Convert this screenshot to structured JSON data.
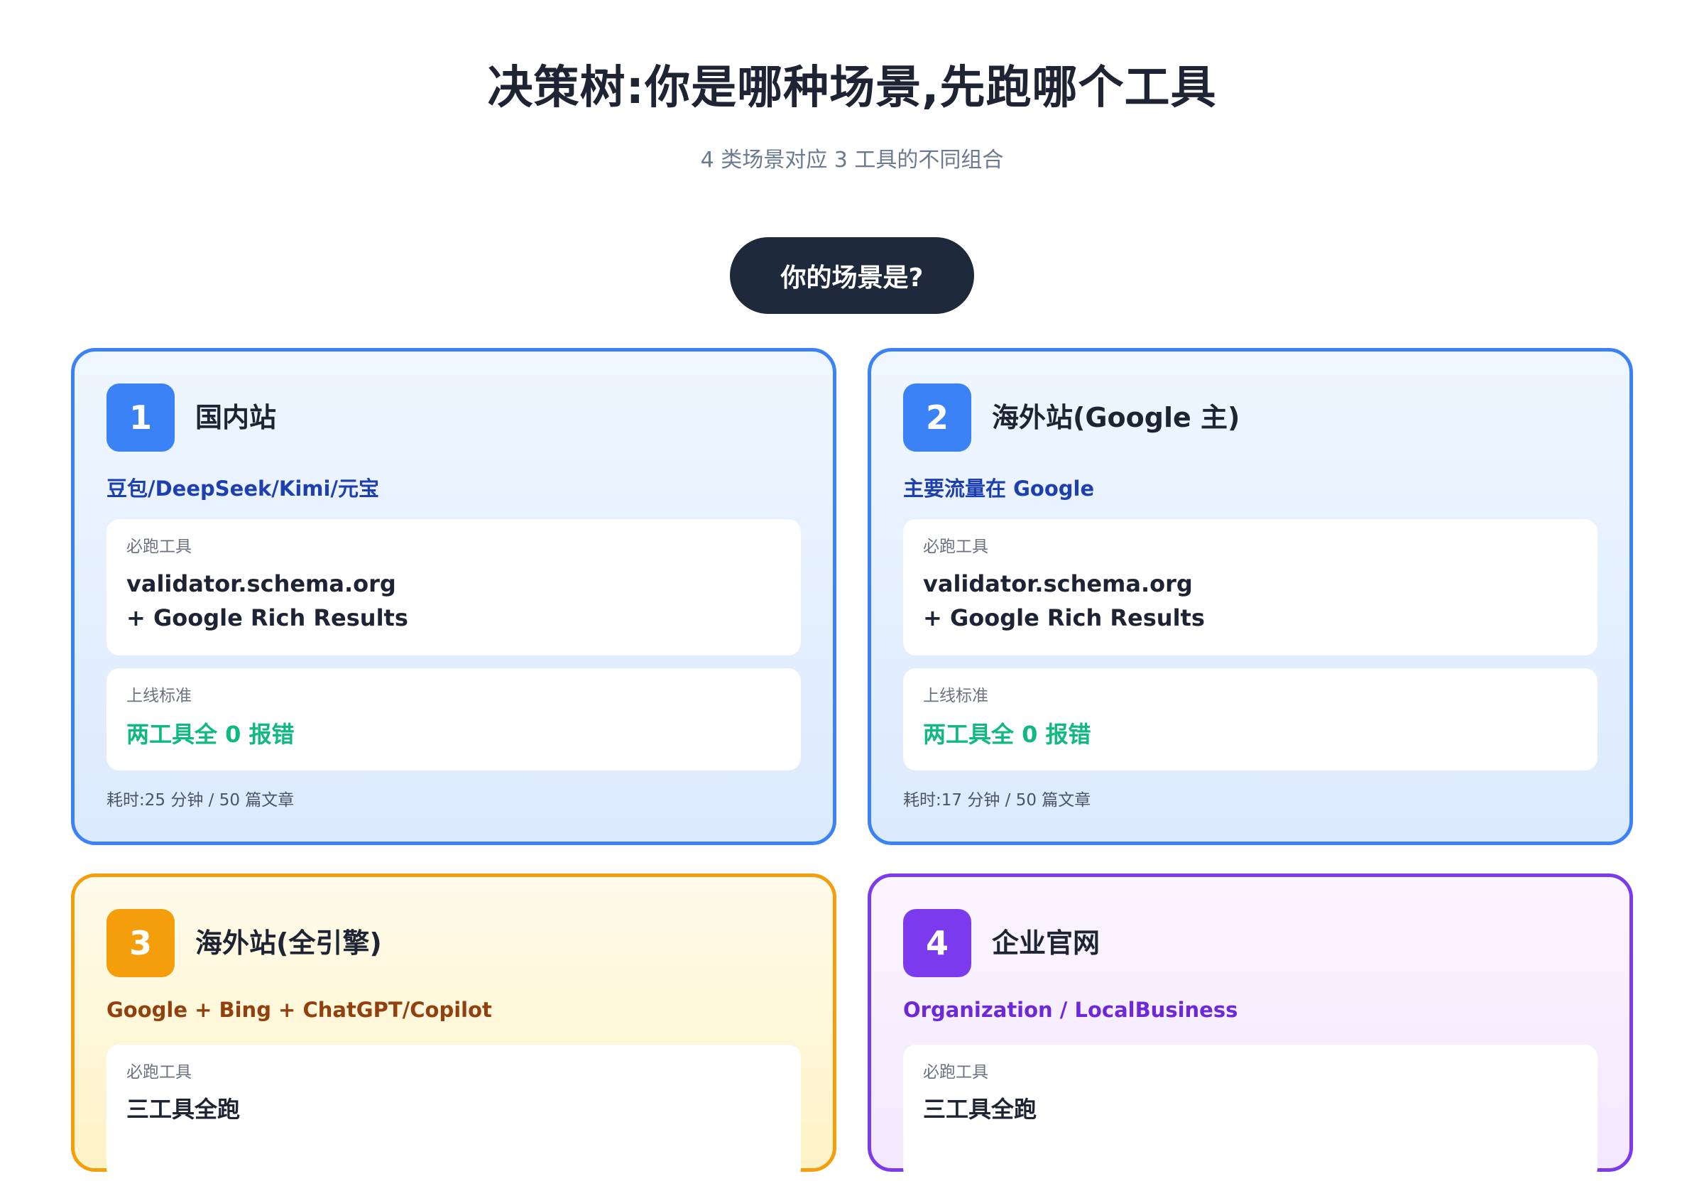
{
  "header": {
    "title": "决策树:你是哪种场景,先跑哪个工具",
    "subtitle": "4 类场景对应 3 工具的不同组合"
  },
  "root": {
    "label": "你的场景是?"
  },
  "cards": [
    {
      "number": "1",
      "title": "国内站",
      "tagline": "豆包/DeepSeek/Kimi/元宝",
      "tools_label": "必跑工具",
      "tools_value": "validator.schema.org\n+ Google Rich Results",
      "standard_label": "上线标准",
      "standard_value": "两工具全 0 报错",
      "footer": "耗时:25 分钟 / 50 篇文章",
      "accent": "#3b82f6"
    },
    {
      "number": "2",
      "title": "海外站(Google 主)",
      "tagline": "主要流量在 Google",
      "tools_label": "必跑工具",
      "tools_value": "validator.schema.org\n+ Google Rich Results",
      "standard_label": "上线标准",
      "standard_value": "两工具全 0 报错",
      "footer": "耗时:17 分钟 / 50 篇文章",
      "accent": "#3b82f6"
    },
    {
      "number": "3",
      "title": "海外站(全引擎)",
      "tagline": "Google + Bing + ChatGPT/Copilot",
      "tools_label": "必跑工具",
      "tools_value": "三工具全跑",
      "accent": "#f59e0b"
    },
    {
      "number": "4",
      "title": "企业官网",
      "tagline": "Organization / LocalBusiness",
      "tools_label": "必跑工具",
      "tools_value": "三工具全跑",
      "accent": "#7c3aed"
    }
  ],
  "colors": {
    "success": "#10b981",
    "root_pill": "#1e293b"
  }
}
